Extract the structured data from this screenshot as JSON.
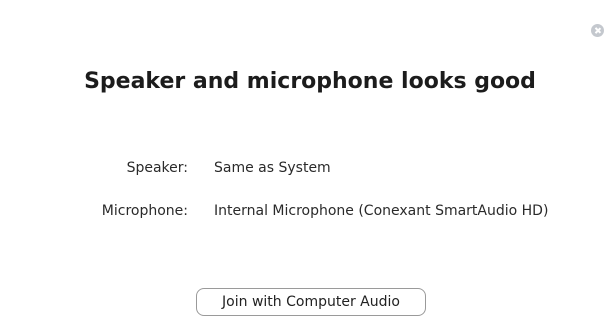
{
  "dialog": {
    "title": "Speaker and microphone looks good",
    "close_icon": "close-icon",
    "speaker": {
      "label": "Speaker:",
      "value": "Same as System"
    },
    "microphone": {
      "label": "Microphone:",
      "value": "Internal Microphone (Conexant SmartAudio HD)"
    },
    "join_button_label": "Join with Computer Audio"
  }
}
